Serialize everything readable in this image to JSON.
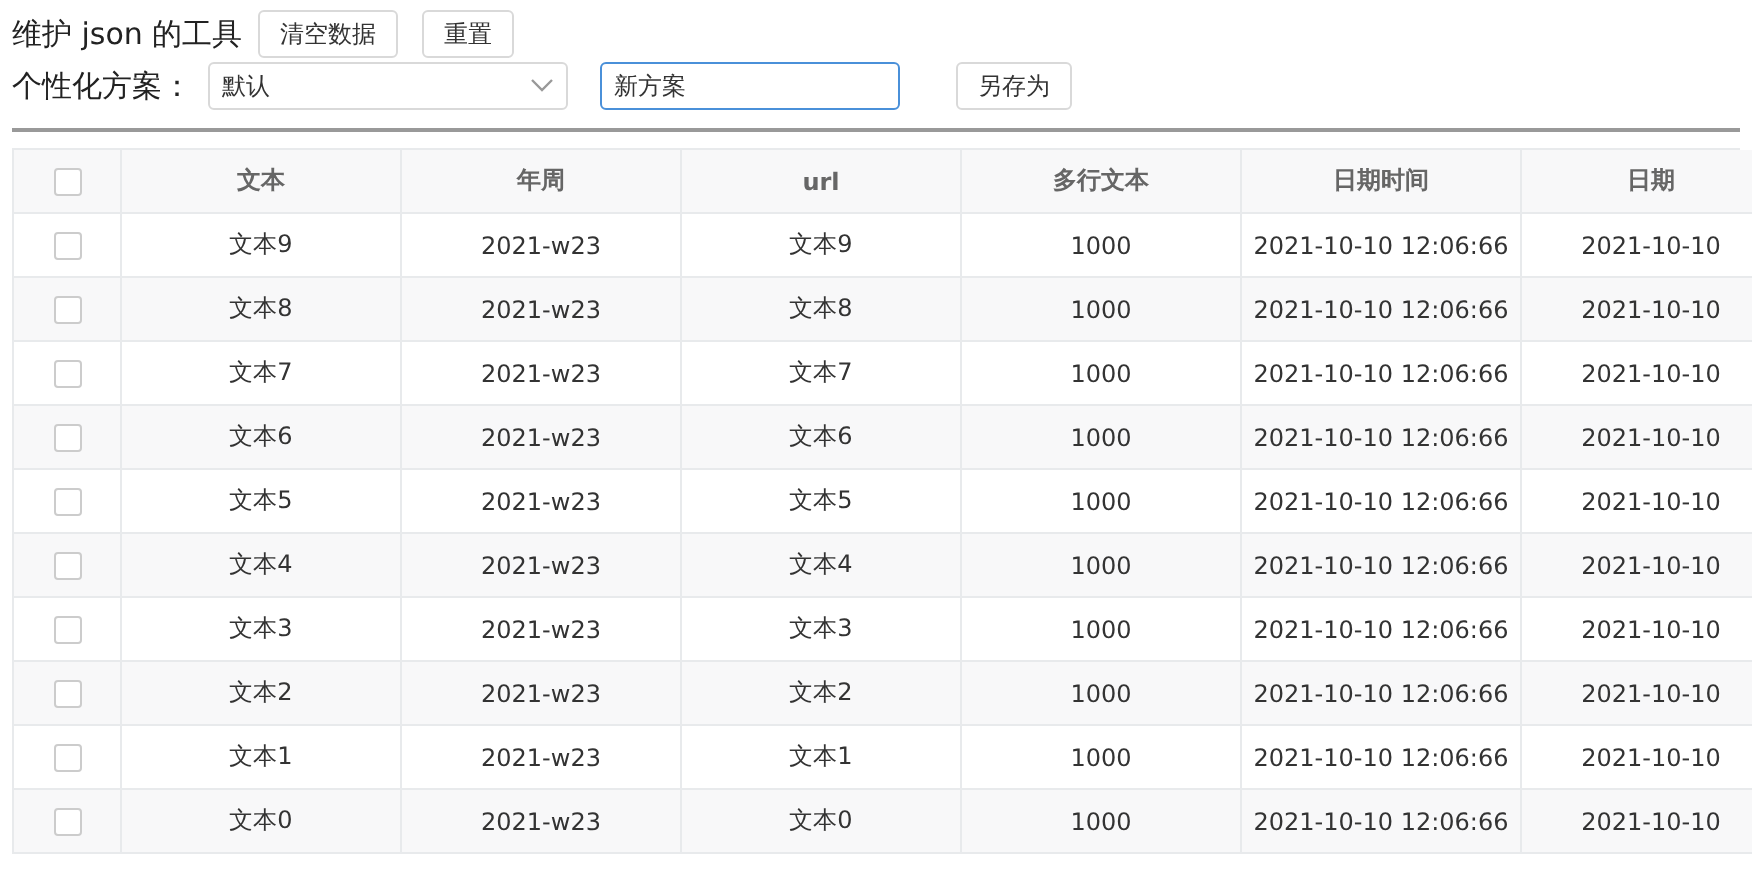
{
  "title": "维护 json 的工具",
  "toolbar_buttons": [
    "清空数据",
    "重置"
  ],
  "scheme": {
    "label": "个性化方案：",
    "select_value": "默认",
    "name_value": "新方案",
    "save_button": "另存为"
  },
  "table": {
    "columns": [
      "文本",
      "年周",
      "url",
      "多行文本",
      "日期时间",
      "日期"
    ],
    "header_checked": false,
    "rows": [
      {
        "checked": false,
        "cells": [
          "文本9",
          "2021-w23",
          "文本9",
          "1000",
          "2021-10-10 12:06:66",
          "2021-10-10"
        ]
      },
      {
        "checked": false,
        "cells": [
          "文本8",
          "2021-w23",
          "文本8",
          "1000",
          "2021-10-10 12:06:66",
          "2021-10-10"
        ]
      },
      {
        "checked": false,
        "cells": [
          "文本7",
          "2021-w23",
          "文本7",
          "1000",
          "2021-10-10 12:06:66",
          "2021-10-10"
        ]
      },
      {
        "checked": false,
        "cells": [
          "文本6",
          "2021-w23",
          "文本6",
          "1000",
          "2021-10-10 12:06:66",
          "2021-10-10"
        ]
      },
      {
        "checked": false,
        "cells": [
          "文本5",
          "2021-w23",
          "文本5",
          "1000",
          "2021-10-10 12:06:66",
          "2021-10-10"
        ]
      },
      {
        "checked": false,
        "cells": [
          "文本4",
          "2021-w23",
          "文本4",
          "1000",
          "2021-10-10 12:06:66",
          "2021-10-10"
        ]
      },
      {
        "checked": false,
        "cells": [
          "文本3",
          "2021-w23",
          "文本3",
          "1000",
          "2021-10-10 12:06:66",
          "2021-10-10"
        ]
      },
      {
        "checked": false,
        "cells": [
          "文本2",
          "2021-w23",
          "文本2",
          "1000",
          "2021-10-10 12:06:66",
          "2021-10-10"
        ]
      },
      {
        "checked": false,
        "cells": [
          "文本1",
          "2021-w23",
          "文本1",
          "1000",
          "2021-10-10 12:06:66",
          "2021-10-10"
        ]
      },
      {
        "checked": false,
        "cells": [
          "文本0",
          "2021-w23",
          "文本0",
          "1000",
          "2021-10-10 12:06:66",
          "2021-10-10"
        ]
      }
    ]
  }
}
